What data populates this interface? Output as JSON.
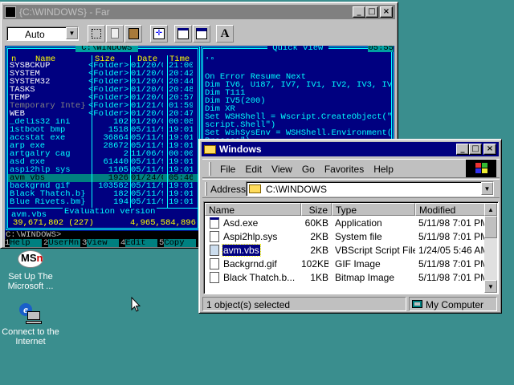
{
  "desktop": {
    "icons": [
      {
        "label1": "Set Up The",
        "label2": "Microsoft ..."
      },
      {
        "label1": "Connect to the",
        "label2": "Internet"
      }
    ]
  },
  "far": {
    "title": "{C:\\WINDOWS} - Far",
    "font_select": "Auto",
    "panel_title": " C:\\WINDOWS ",
    "qv_title": " Quick view ",
    "clock": "05:55",
    "headers": {
      "n": "n",
      "name": "Name",
      "size": "Size",
      "date": "Date",
      "time": "Time"
    },
    "files": [
      [
        "SYSBCKUP",
        "<Folder>",
        "01/20/03",
        "21:00"
      ],
      [
        "SYSTEM",
        "<Folder>",
        "01/20/03",
        "20:42"
      ],
      [
        "SYSTEM32",
        "<Folder>",
        "01/20/03",
        "20:44"
      ],
      [
        "TASKS",
        "<Folder>",
        "01/20/03",
        "20:48"
      ],
      [
        "TEMP",
        "<Folder>",
        "01/20/03",
        "20:57"
      ],
      [
        "Temporary Inte}",
        "<Folder>",
        "01/21/03",
        "01:59"
      ],
      [
        "WEB",
        "<Folder>",
        "01/20/03",
        "20:47"
      ],
      [
        "_delis32  ini",
        "102",
        "01/20/05",
        "00:08"
      ],
      [
        "1stboot   bmp",
        "1518",
        "05/11/98",
        "19:01"
      ],
      [
        "accstat   exe",
        "36864",
        "05/11/98",
        "19:01"
      ],
      [
        "arp       exe",
        "28672",
        "05/11/98",
        "19:01"
      ],
      [
        "artgalry  cag",
        "2",
        "11/06/97",
        "00:00"
      ],
      [
        "asd       exe",
        "61440",
        "05/11/98",
        "19:01"
      ],
      [
        "aspi2hlp  sys",
        "1105",
        "05/11/98",
        "19:01"
      ],
      [
        "avm       vbs",
        "1926",
        "01/24/05",
        "05:46"
      ],
      [
        "backgrnd  gif",
        "103582",
        "05/11/98",
        "19:01"
      ],
      [
        "Black Thatch.b}",
        "182",
        "05/11/98",
        "19:01"
      ],
      [
        "Blue Rivets.bm}",
        "194",
        "05/11/98",
        "19:01"
      ]
    ],
    "status_name": "avm.vbs",
    "totals": " 39,671,802 (227) ",
    "free": "4,965,584,896",
    "eval": "Evaluation version",
    "qv_lines": [
      "'°",
      "",
      "On Error Resume Next",
      "Dim IV6, U187, IV7, IV1, IV2, IV3, IV4",
      "Dim T111",
      "Dim IV5(200)",
      "Dim XR",
      "Set WSHShell = Wscript.CreateObject(\"W",
      "script.Shell\")",
      "Set WshSysEnv = WSHShell.Environment(\"",
      "Process\")"
    ],
    "prompt": "C:\\WINDOWS>",
    "keys": [
      [
        "1",
        "Help"
      ],
      [
        "2",
        "UserMn"
      ],
      [
        "3",
        "View"
      ],
      [
        "4",
        "Edit"
      ],
      [
        "5",
        "Copy"
      ]
    ]
  },
  "explorer": {
    "title": "Windows",
    "menu": [
      "File",
      "Edit",
      "View",
      "Go",
      "Favorites",
      "Help"
    ],
    "address_label": "Address",
    "address": "C:\\WINDOWS",
    "columns": [
      "Name",
      "Size",
      "Type",
      "Modified"
    ],
    "rows": [
      [
        "Asd.exe",
        "60KB",
        "Application",
        "5/11/98 7:01 PM"
      ],
      [
        "Aspi2hlp.sys",
        "2KB",
        "System file",
        "5/11/98 7:01 PM"
      ],
      [
        "avm.vbs",
        "2KB",
        "VBScript Script File",
        "1/24/05 5:46 AM"
      ],
      [
        "Backgrnd.gif",
        "102KB",
        "GIF Image",
        "5/11/98 7:01 PM"
      ],
      [
        "Black Thatch.b...",
        "1KB",
        "Bitmap Image",
        "5/11/98 7:01 PM"
      ]
    ],
    "status_left": "1 object(s) selected",
    "status_right": "My Computer"
  },
  "colors": {
    "desktop": "#3a8e8e",
    "far_bg": "#000080",
    "far_cyan": "#00ffff",
    "far_yellow": "#ffff00",
    "far_sel": "#008080"
  }
}
